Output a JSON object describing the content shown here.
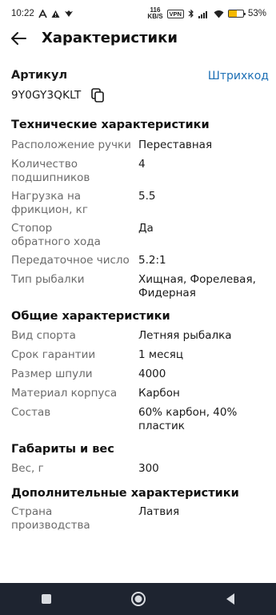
{
  "status_bar": {
    "time": "10:22",
    "speed_top": "116",
    "speed_bottom": "KB/S",
    "vpn": "VPN",
    "battery": "53%",
    "battery_level": 0.53,
    "icons": [
      "a-notification-icon",
      "warning-icon",
      "game-controller-icon",
      "bluetooth-icon",
      "signal-icon",
      "wifi-icon"
    ]
  },
  "app_bar": {
    "title": "Характеристики",
    "back_icon": "arrow-left-icon"
  },
  "article": {
    "label": "Артикул",
    "value": "9Y0GY3QKLT",
    "barcode_link": "Штрихкод",
    "copy_icon": "copy-icon",
    "link_color": "#1c6fb5"
  },
  "sections": [
    {
      "title": "Технические характеристики",
      "rows": [
        {
          "name": "Расположение ручки",
          "value": "Переставная"
        },
        {
          "name": "Количество подшипников",
          "value": "4"
        },
        {
          "name": "Нагрузка на фрикцион, кг",
          "value": "5.5"
        },
        {
          "name": "Стопор обратного хода",
          "value": "Да"
        },
        {
          "name": "Передаточное число",
          "value": "5.2:1"
        },
        {
          "name": "Тип рыбалки",
          "value": "Хищная, Форелевая, Фидерная"
        }
      ]
    },
    {
      "title": "Общие характеристики",
      "rows": [
        {
          "name": "Вид спорта",
          "value": "Летняя рыбалка"
        },
        {
          "name": "Срок гарантии",
          "value": "1 месяц"
        },
        {
          "name": "Размер шпули",
          "value": "4000"
        },
        {
          "name": "Материал корпуса",
          "value": "Карбон"
        },
        {
          "name": "Состав",
          "value": "60% карбон, 40% пластик"
        }
      ]
    },
    {
      "title": "Габариты и вес",
      "rows": [
        {
          "name": "Вес, г",
          "value": "300"
        }
      ]
    },
    {
      "title": "Дополнительные характеристики",
      "rows": [
        {
          "name": "Страна производства",
          "value": "Латвия"
        }
      ]
    }
  ],
  "nav_bar": {
    "icons": [
      "recent-apps-icon",
      "home-icon",
      "back-triangle-icon"
    ],
    "background": "#1e2430"
  }
}
